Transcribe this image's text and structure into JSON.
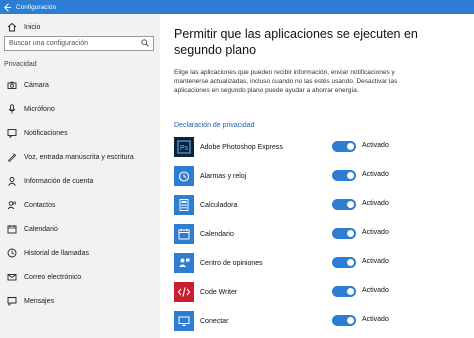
{
  "window": {
    "title": "Configuración"
  },
  "sidebar": {
    "home_label": "Inicio",
    "search_placeholder": "Buscar una configuración",
    "section_label": "Privacidad",
    "items": [
      {
        "label": "Cámara",
        "icon": "camera-icon"
      },
      {
        "label": "Micrófono",
        "icon": "microphone-icon"
      },
      {
        "label": "Notificaciones",
        "icon": "notifications-icon"
      },
      {
        "label": "Voz, entrada manuscrita y escritura",
        "icon": "speech-icon"
      },
      {
        "label": "Información de cuenta",
        "icon": "account-info-icon"
      },
      {
        "label": "Contactos",
        "icon": "contacts-icon"
      },
      {
        "label": "Calendario",
        "icon": "calendar-icon"
      },
      {
        "label": "Historial de llamadas",
        "icon": "call-history-icon"
      },
      {
        "label": "Correo electrónico",
        "icon": "email-icon"
      },
      {
        "label": "Mensajes",
        "icon": "messages-icon"
      }
    ]
  },
  "main": {
    "heading": "Permitir que las aplicaciones se ejecuten en segundo plano",
    "description": "Elige las aplicaciones que pueden recibir información, enviar notificaciones y mantenerse actualizadas, incluso cuando no las estés usando. Desactivar las aplicaciones en segundo plano puede ayudar a ahorrar energía.",
    "privacy_link": "Declaración de privacidad",
    "apps": [
      {
        "name": "Adobe Photoshop Express",
        "state": "Activado",
        "tile_color": "#0b1f3f",
        "icon": "photoshop-icon"
      },
      {
        "name": "Alarmas y reloj",
        "state": "Activado",
        "tile_color": "#2d7dd2",
        "icon": "alarm-clock-icon"
      },
      {
        "name": "Calculadora",
        "state": "Activado",
        "tile_color": "#2d7dd2",
        "icon": "calculator-icon"
      },
      {
        "name": "Calendario",
        "state": "Activado",
        "tile_color": "#2d7dd2",
        "icon": "calendar-app-icon"
      },
      {
        "name": "Centro de opiniones",
        "state": "Activado",
        "tile_color": "#2d7dd2",
        "icon": "feedback-hub-icon"
      },
      {
        "name": "Code Writer",
        "state": "Activado",
        "tile_color": "#c8202f",
        "icon": "code-writer-icon"
      },
      {
        "name": "Conectar",
        "state": "Activado",
        "tile_color": "#2d7dd2",
        "icon": "connect-icon"
      }
    ]
  },
  "colors": {
    "accent": "#2d7dd2",
    "link": "#1a5fb4",
    "sidebar_bg": "#f2f2f2"
  }
}
